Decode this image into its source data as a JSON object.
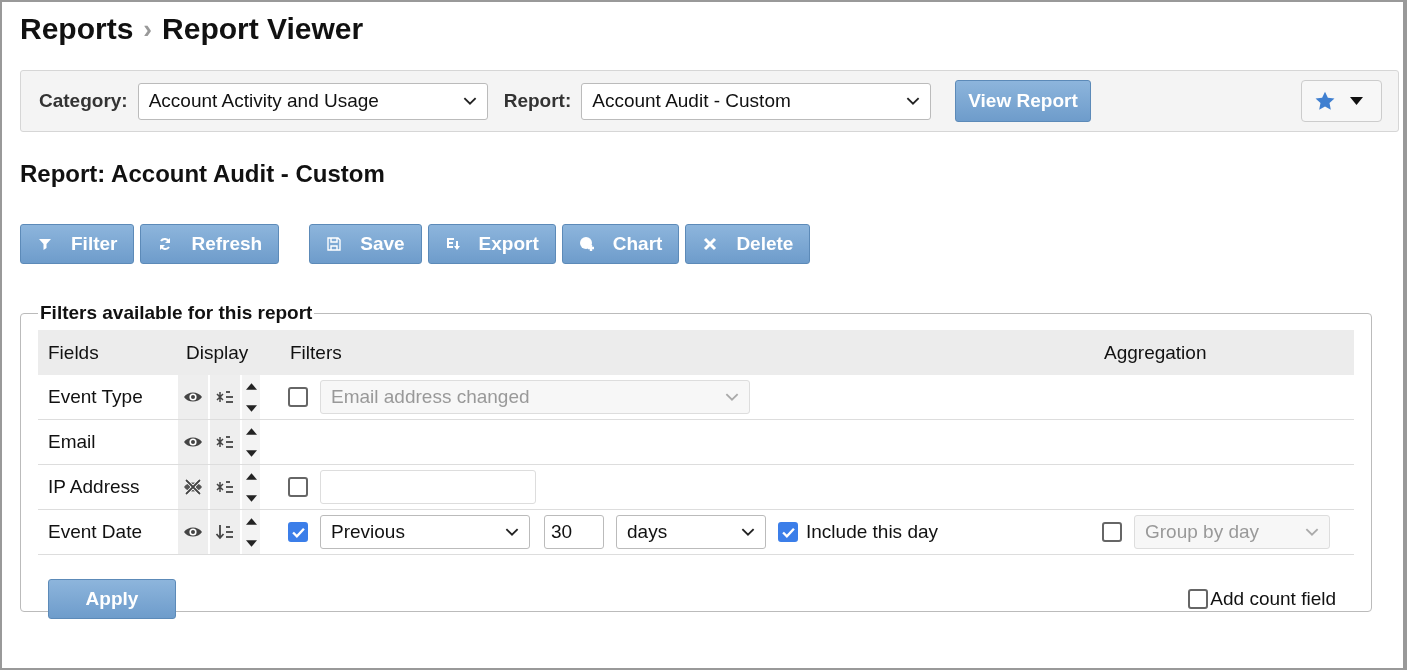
{
  "breadcrumb": {
    "parent": "Reports",
    "separator": "›",
    "current": "Report Viewer"
  },
  "toolbar": {
    "category_label": "Category:",
    "category_value": "Account Activity and Usage",
    "report_label": "Report:",
    "report_value": "Account Audit - Custom",
    "view_button": "View Report"
  },
  "report_title": "Report: Account Audit - Custom",
  "actions": [
    {
      "label": "Filter",
      "kind": "filter"
    },
    {
      "label": "Refresh",
      "kind": "refresh"
    },
    {
      "label": "Save",
      "kind": "save"
    },
    {
      "label": "Export",
      "kind": "export"
    },
    {
      "label": "Chart",
      "kind": "chart"
    },
    {
      "label": "Delete",
      "kind": "delete"
    }
  ],
  "filters": {
    "legend": "Filters available for this report",
    "columns": [
      "Fields",
      "Display",
      "Filters",
      "Aggregation"
    ],
    "rows": [
      {
        "field": "Event Type",
        "visible": true,
        "sorted": false,
        "filter": {
          "kind": "select",
          "checked": false,
          "value": "Email address changed",
          "disabled": true
        }
      },
      {
        "field": "Email",
        "visible": true,
        "sorted": false,
        "filter": {
          "kind": "none"
        }
      },
      {
        "field": "IP Address",
        "visible": false,
        "sorted": false,
        "filter": {
          "kind": "text",
          "checked": false
        }
      },
      {
        "field": "Event Date",
        "visible": true,
        "sorted": true,
        "filter": {
          "kind": "range",
          "checked": true,
          "mode": "Previous",
          "count": "30",
          "unit": "days",
          "include_checked": true,
          "include_label": "Include this day"
        },
        "aggregation": {
          "checked": false,
          "value": "Group by day",
          "disabled": true
        }
      }
    ],
    "apply_button": "Apply",
    "add_count": {
      "checked": false,
      "label": "Add count field"
    }
  }
}
